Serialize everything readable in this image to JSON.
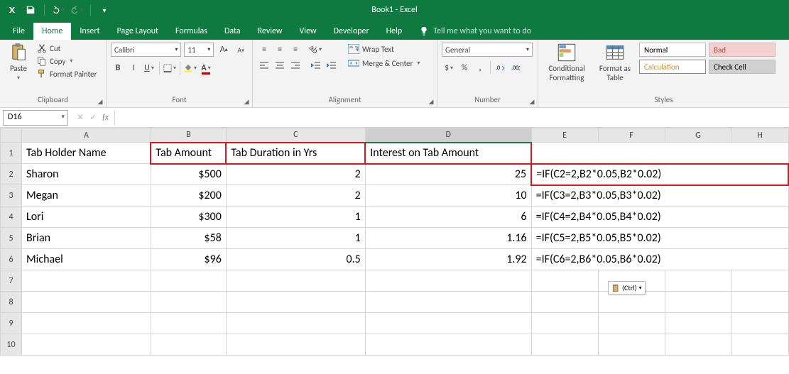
{
  "title": "Book1  -  Excel",
  "qat": {
    "save": "save-icon",
    "undo": "undo-icon",
    "redo": "redo-icon",
    "customize": "customize-qat"
  },
  "tabs": {
    "file": "File",
    "home": "Home",
    "insert": "Insert",
    "pagelayout": "Page Layout",
    "formulas": "Formulas",
    "data": "Data",
    "review": "Review",
    "view": "View",
    "developer": "Developer",
    "help": "Help",
    "tellme": "Tell me what you want to do"
  },
  "ribbon": {
    "clipboard": {
      "paste": "Paste",
      "cut": "Cut",
      "copy": "Copy",
      "format_painter": "Format Painter",
      "group": "Clipboard"
    },
    "font": {
      "name": "Calibri",
      "size": "11",
      "group": "Font"
    },
    "alignment": {
      "wrap": "Wrap Text",
      "merge": "Merge & Center",
      "group": "Alignment"
    },
    "number": {
      "format": "General",
      "group": "Number"
    },
    "styles": {
      "cf": "Conditional Formatting",
      "fat": "Format as Table",
      "normal": "Normal",
      "bad": "Bad",
      "calc": "Calculation",
      "check": "Check Cell",
      "group": "Styles"
    }
  },
  "formula_bar": {
    "namebox": "D16",
    "fx_label": "fx",
    "value": ""
  },
  "columns": {
    "A": "A",
    "B": "B",
    "C": "C",
    "D": "D",
    "E": "E",
    "F": "F",
    "G": "G",
    "H": "H"
  },
  "col_widths": {
    "A": 182,
    "B": 106,
    "C": 196,
    "D": 234,
    "E": 94,
    "F": 94,
    "G": 94,
    "H": 80
  },
  "rows": {
    "1": {
      "A": "Tab Holder Name",
      "B": "Tab Amount",
      "C": "Tab Duration in Yrs",
      "D": "Interest on Tab Amount",
      "E": ""
    },
    "2": {
      "A": "Sharon",
      "B": "$500",
      "C": "2",
      "D": "25",
      "E": "=IF(C2=2,B2*0.05,B2*0.02)"
    },
    "3": {
      "A": "Megan",
      "B": "$200",
      "C": "2",
      "D": "10",
      "E": "=IF(C3=2,B3*0.05,B3*0.02)"
    },
    "4": {
      "A": "Lori",
      "B": "$300",
      "C": "1",
      "D": "6",
      "E": "=IF(C4=2,B4*0.05,B4*0.02)"
    },
    "5": {
      "A": "Brian",
      "B": "$58",
      "C": "1",
      "D": "1.16",
      "E": "=IF(C5=2,B5*0.05,B5*0.02)"
    },
    "6": {
      "A": "Michael",
      "B": "$96",
      "C": "0.5",
      "D": "1.92",
      "E": "=IF(C6=2,B6*0.05,B6*0.02)"
    },
    "7": {
      "A": "",
      "B": "",
      "C": "",
      "D": "",
      "E": ""
    },
    "8": {
      "A": "",
      "B": "",
      "C": "",
      "D": "",
      "E": ""
    },
    "9": {
      "A": "",
      "B": "",
      "C": "",
      "D": "",
      "E": ""
    },
    "10": {
      "A": "",
      "B": "",
      "C": "",
      "D": "",
      "E": ""
    }
  },
  "paste_options": {
    "label": "(Ctrl)"
  }
}
